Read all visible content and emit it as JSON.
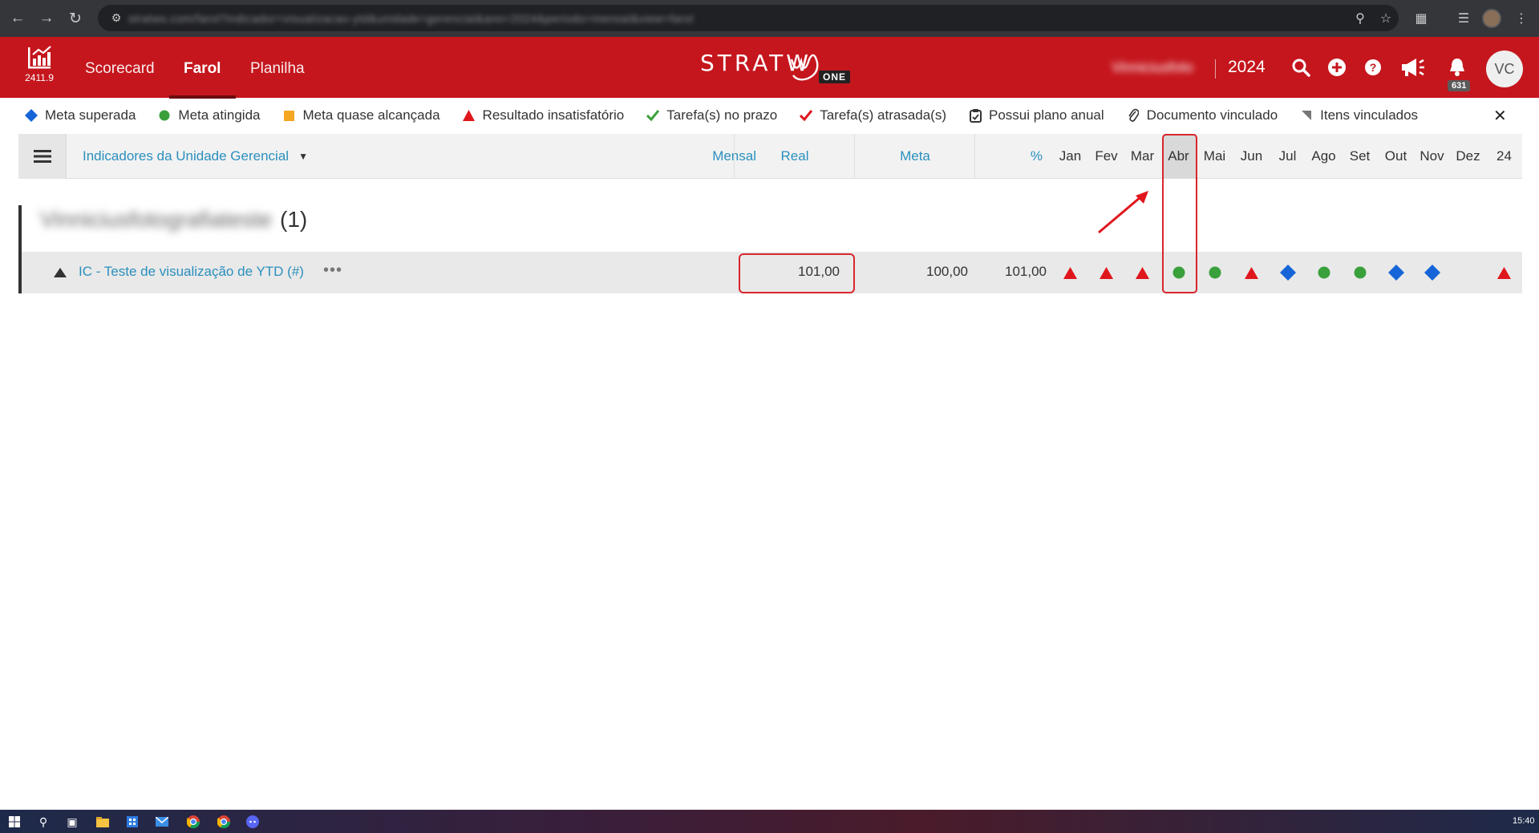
{
  "app": {
    "version": "2411.9",
    "nav": {
      "tabs": [
        "Scorecard",
        "Farol",
        "Planilha"
      ],
      "active": "Farol"
    },
    "logo_text": "STRATW",
    "logo_badge": "ONE",
    "unit_name": "Vinniciusfoto",
    "year": "2024",
    "notifications_count": "631",
    "avatar_initials": "VC",
    "brand_color": "#c5161d"
  },
  "browser": {
    "url": "stratws.com/farol?indicador=visualizacao-ytd&unidade=gerencial&ano=2024&periodo=mensal&view=farol"
  },
  "legend": {
    "items": [
      {
        "symbol": "blue-diamond-icon",
        "label": "Meta superada"
      },
      {
        "symbol": "green-circle-icon",
        "label": "Meta atingida"
      },
      {
        "symbol": "orange-square-icon",
        "label": "Meta quase alcançada"
      },
      {
        "symbol": "red-triangle-icon",
        "label": "Resultado insatisfatório"
      },
      {
        "symbol": "green-check-icon",
        "label": "Tarefa(s) no prazo"
      },
      {
        "symbol": "red-check-icon",
        "label": "Tarefa(s) atrasada(s)"
      },
      {
        "symbol": "clipboard-icon",
        "label": "Possui plano anual"
      },
      {
        "symbol": "paperclip-icon",
        "label": "Documento vinculado"
      },
      {
        "symbol": "corner-flag-icon",
        "label": "Itens vinculados"
      }
    ],
    "close": "✕"
  },
  "table": {
    "group_select": "Indicadores da Unidade Gerencial",
    "columns": {
      "period": "Mensal",
      "real": "Real",
      "meta": "Meta",
      "percent": "%"
    },
    "months": [
      "Jan",
      "Fev",
      "Mar",
      "Abr",
      "Mai",
      "Jun",
      "Jul",
      "Ago",
      "Set",
      "Out",
      "Nov",
      "Dez",
      "24"
    ]
  },
  "group": {
    "name": "Vinniciusfotografiateste",
    "count": "(1)"
  },
  "rows": [
    {
      "label": "IC - Teste de visualização de YTD (#)",
      "more": "•••",
      "real": "101,00",
      "meta": "100,00",
      "percent": "101,00",
      "status": [
        "triangle",
        "triangle",
        "triangle",
        "circle",
        "circle",
        "triangle",
        "diamond",
        "circle",
        "circle",
        "diamond",
        "diamond",
        "none",
        "triangle"
      ]
    }
  ],
  "status_colors": {
    "triangle": "#e0161d",
    "circle": "#3aa03c",
    "diamond": "#1565d8",
    "square": "#f5a623"
  },
  "taskbar": {
    "time": "15:40"
  }
}
